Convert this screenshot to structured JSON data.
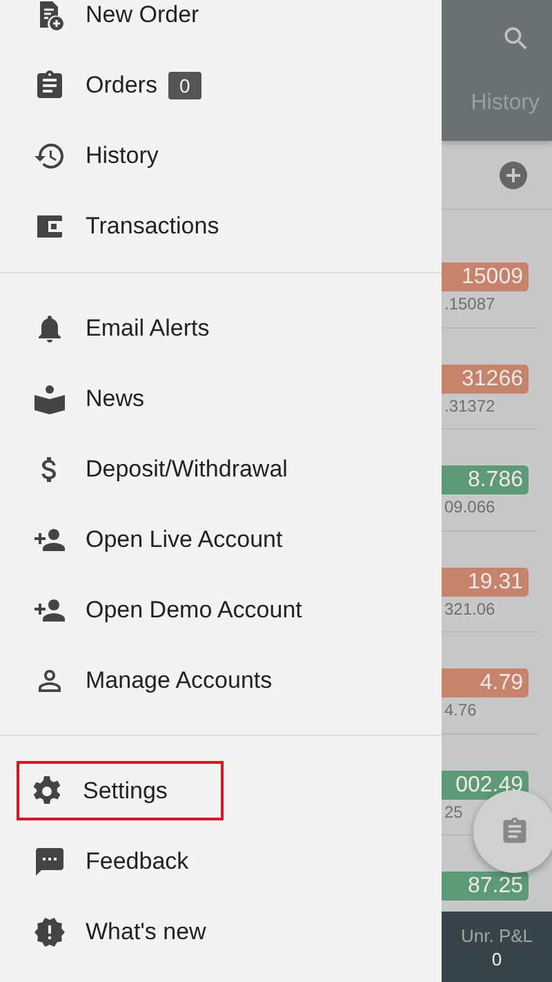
{
  "drawer": {
    "sections": [
      {
        "items": [
          {
            "label": "New Order",
            "highlighted": false
          },
          {
            "label": "Orders",
            "badge": "0",
            "highlighted": false
          },
          {
            "label": "History",
            "highlighted": false
          },
          {
            "label": "Transactions",
            "highlighted": false
          }
        ]
      },
      {
        "items": [
          {
            "label": "Email Alerts",
            "highlighted": false
          },
          {
            "label": "News",
            "highlighted": false
          },
          {
            "label": "Deposit/Withdrawal",
            "highlighted": false
          },
          {
            "label": "Open Live Account",
            "highlighted": false
          },
          {
            "label": "Open Demo Account",
            "highlighted": false
          },
          {
            "label": "Manage Accounts",
            "highlighted": false
          }
        ]
      },
      {
        "items": [
          {
            "label": "Settings",
            "highlighted": true
          },
          {
            "label": "Feedback",
            "highlighted": false
          },
          {
            "label": "What's new",
            "highlighted": false
          }
        ]
      }
    ]
  },
  "background": {
    "header": {
      "tab": "History"
    },
    "quotes": [
      {
        "price": "15009",
        "color": "#c7826b",
        "sub": ".15087"
      },
      {
        "price": "31266",
        "color": "#c7826b",
        "sub": ".31372"
      },
      {
        "price": "8.786",
        "color": "#5c9a78",
        "sub": "09.066"
      },
      {
        "price": "19.31",
        "color": "#c7826b",
        "sub": "321.06"
      },
      {
        "price": "4.79",
        "color": "#c7826b",
        "sub": "4.76"
      },
      {
        "price": "002.49",
        "color": "#5c9a78",
        "sub": "25"
      },
      {
        "price": "87.25",
        "color": "#5c9a78"
      }
    ],
    "footer": {
      "label": "Unr. P&L",
      "value": "0"
    }
  }
}
